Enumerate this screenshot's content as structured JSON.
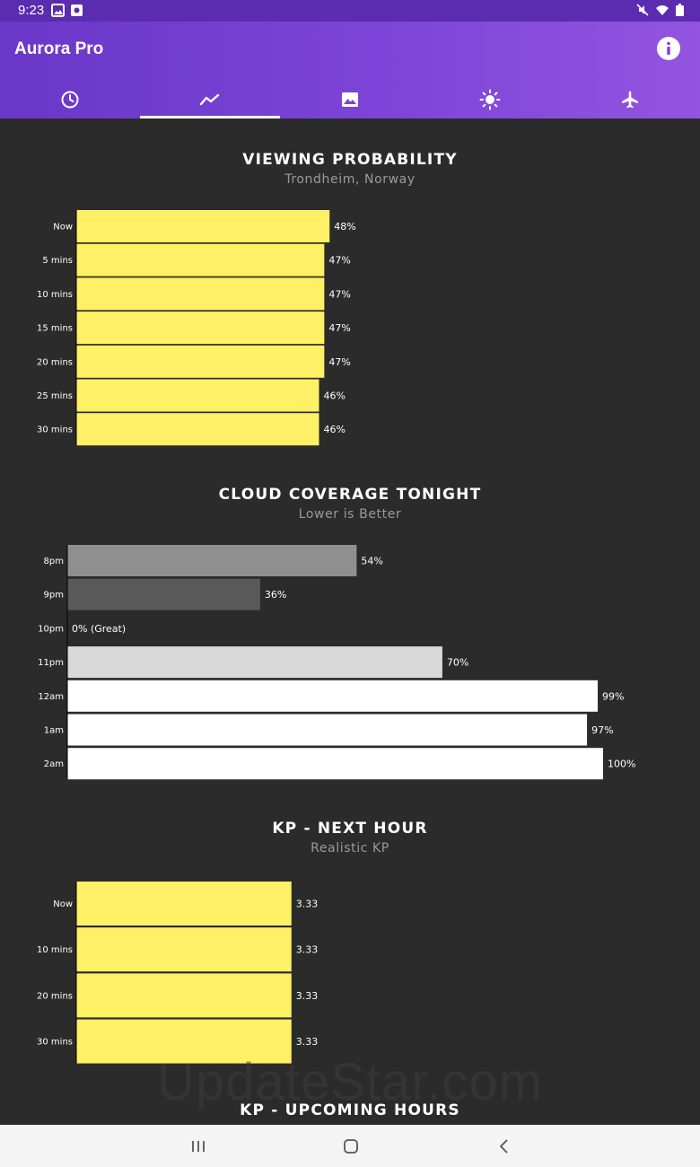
{
  "status_bar": {
    "time": "9:23"
  },
  "app_bar": {
    "title": "Aurora Pro"
  },
  "tabs": [
    {
      "icon": "clock-icon",
      "active": false
    },
    {
      "icon": "trend-line-icon",
      "active": true
    },
    {
      "icon": "image-icon",
      "active": false
    },
    {
      "icon": "sun-icon",
      "active": false
    },
    {
      "icon": "airplane-icon",
      "active": false
    }
  ],
  "sections": {
    "viewing": {
      "title": "VIEWING PROBABILITY",
      "subtitle": "Trondheim, Norway"
    },
    "cloud": {
      "title": "CLOUD COVERAGE TONIGHT",
      "subtitle": "Lower is Better"
    },
    "kp_next": {
      "title": "KP - NEXT HOUR",
      "subtitle": "Realistic KP"
    },
    "kp_upcoming": {
      "title": "KP - UPCOMING HOURS"
    }
  },
  "watermark": "UpdateStar.com",
  "colors": {
    "accent": "#7c45d8",
    "bar_yellow": "#fff066",
    "background": "#2b2b2b"
  },
  "chart_data": [
    {
      "type": "bar",
      "orientation": "horizontal",
      "title": "VIEWING PROBABILITY",
      "subtitle": "Trondheim, Norway",
      "categories": [
        "Now",
        "5 mins",
        "10 mins",
        "15 mins",
        "20 mins",
        "25 mins",
        "30 mins"
      ],
      "values": [
        48,
        47,
        47,
        47,
        47,
        46,
        46
      ],
      "value_labels": [
        "48%",
        "47%",
        "47%",
        "47%",
        "47%",
        "46%",
        "46%"
      ],
      "xlim": [
        0,
        100
      ],
      "color": "#fff066"
    },
    {
      "type": "bar",
      "orientation": "horizontal",
      "title": "CLOUD COVERAGE TONIGHT",
      "subtitle": "Lower is Better",
      "categories": [
        "8pm",
        "9pm",
        "10pm",
        "11pm",
        "12am",
        "1am",
        "2am"
      ],
      "values": [
        54,
        36,
        0,
        70,
        99,
        97,
        100
      ],
      "value_labels": [
        "54%",
        "36%",
        "0% (Great)",
        "70%",
        "99%",
        "97%",
        "100%"
      ],
      "colors": [
        "#8f8f8f",
        "#595959",
        "#2b2b2b",
        "#d9d9d9",
        "#ffffff",
        "#ffffff",
        "#ffffff"
      ],
      "xlim": [
        0,
        100
      ]
    },
    {
      "type": "bar",
      "orientation": "horizontal",
      "title": "KP - NEXT HOUR",
      "subtitle": "Realistic KP",
      "categories": [
        "Now",
        "10 mins",
        "20 mins",
        "30 mins"
      ],
      "values": [
        3.33,
        3.33,
        3.33,
        3.33
      ],
      "value_labels": [
        "3.33",
        "3.33",
        "3.33",
        "3.33"
      ],
      "xlim": [
        0,
        9
      ],
      "color": "#fff066"
    }
  ]
}
